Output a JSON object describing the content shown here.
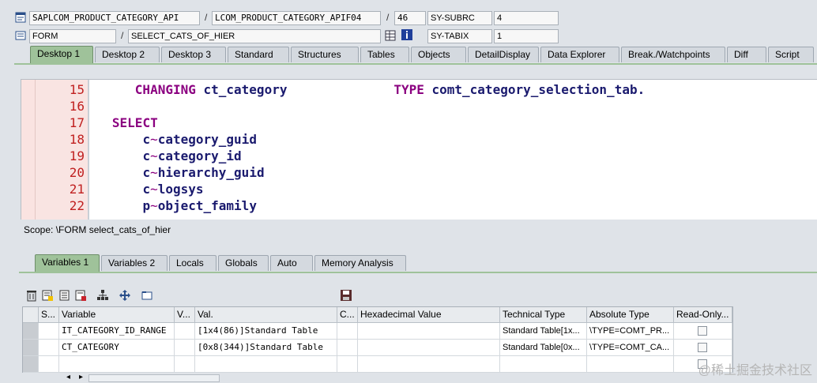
{
  "header": {
    "row1": {
      "program": "SAPLCOM_PRODUCT_CATEGORY_API",
      "sep1": "/",
      "include": "LCOM_PRODUCT_CATEGORY_APIF04",
      "sep2": "/",
      "line": "46",
      "sysvar_label": "SY-SUBRC",
      "sysvar_value": "4"
    },
    "row2": {
      "type": "FORM",
      "sep1": "/",
      "name": "SELECT_CATS_OF_HIER",
      "sysvar_label": "SY-TABIX",
      "sysvar_value": "1"
    }
  },
  "main_tabs": [
    "Desktop 1",
    "Desktop 2",
    "Desktop 3",
    "Standard",
    "Structures",
    "Tables",
    "Objects",
    "DetailDisplay",
    "Data Explorer",
    "Break./Watchpoints",
    "Diff",
    "Script"
  ],
  "code": {
    "lines": [
      {
        "num": "15",
        "parts": [
          {
            "t": "      ",
            "c": ""
          },
          {
            "t": "CHANGING",
            "c": "kw"
          },
          {
            "t": " ",
            "c": ""
          },
          {
            "t": "ct_category",
            "c": "id"
          },
          {
            "t": "              ",
            "c": ""
          },
          {
            "t": "TYPE",
            "c": "kw"
          },
          {
            "t": " ",
            "c": ""
          },
          {
            "t": "comt_category_selection_tab.",
            "c": "id"
          }
        ]
      },
      {
        "num": "16",
        "parts": []
      },
      {
        "num": "17",
        "parts": [
          {
            "t": "   ",
            "c": ""
          },
          {
            "t": "SELECT",
            "c": "kw"
          }
        ]
      },
      {
        "num": "18",
        "parts": [
          {
            "t": "       ",
            "c": ""
          },
          {
            "t": "c",
            "c": "id"
          },
          {
            "t": "~",
            "c": "tld"
          },
          {
            "t": "category_guid",
            "c": "id"
          }
        ]
      },
      {
        "num": "19",
        "parts": [
          {
            "t": "       ",
            "c": ""
          },
          {
            "t": "c",
            "c": "id"
          },
          {
            "t": "~",
            "c": "tld"
          },
          {
            "t": "category_id",
            "c": "id"
          }
        ]
      },
      {
        "num": "20",
        "parts": [
          {
            "t": "       ",
            "c": ""
          },
          {
            "t": "c",
            "c": "id"
          },
          {
            "t": "~",
            "c": "tld"
          },
          {
            "t": "hierarchy_guid",
            "c": "id"
          }
        ]
      },
      {
        "num": "21",
        "parts": [
          {
            "t": "       ",
            "c": ""
          },
          {
            "t": "c",
            "c": "id"
          },
          {
            "t": "~",
            "c": "tld"
          },
          {
            "t": "logsys",
            "c": "id"
          }
        ]
      },
      {
        "num": "22",
        "parts": [
          {
            "t": "       ",
            "c": ""
          },
          {
            "t": "p",
            "c": "id"
          },
          {
            "t": "~",
            "c": "tld"
          },
          {
            "t": "object_family",
            "c": "id"
          }
        ]
      }
    ]
  },
  "scope": "Scope: \\FORM select_cats_of_hier",
  "var_tabs": [
    "Variables 1",
    "Variables 2",
    "Locals",
    "Globals",
    "Auto",
    "Memory Analysis"
  ],
  "grid": {
    "headers": [
      "S...",
      "Variable",
      "V...",
      "Val.",
      "C...",
      "Hexadecimal Value",
      "Technical Type",
      "Absolute Type",
      "Read-Only..."
    ],
    "rows": [
      [
        "",
        "IT_CATEGORY_ID_RANGE",
        "",
        "[1x4(86)]Standard Table",
        "",
        "",
        "Standard Table[1x...",
        "\\TYPE=COMT_PR...",
        ""
      ],
      [
        "",
        "CT_CATEGORY",
        "",
        "[0x8(344)]Standard Table",
        "",
        "",
        "Standard Table[0x...",
        "\\TYPE=COMT_CA...",
        ""
      ],
      [
        "",
        "",
        "",
        "",
        "",
        "",
        "",
        "",
        ""
      ]
    ]
  },
  "watermark": "@稀土掘金技术社区",
  "colors": {
    "active_tab": "#9fc29a",
    "keyword": "#8b0080",
    "identifier": "#1a1a6e",
    "line_number": "#c02020"
  }
}
